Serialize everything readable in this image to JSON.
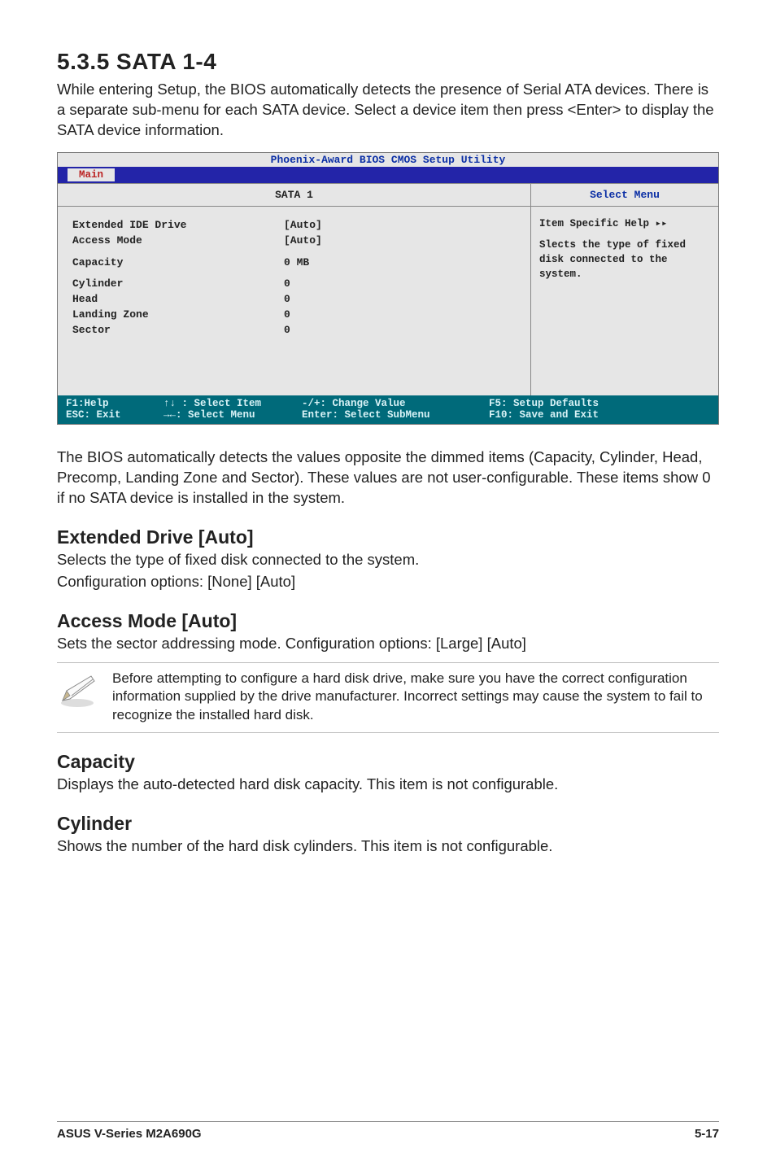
{
  "section_heading": "5.3.5   SATA 1-4",
  "intro_text": "While entering Setup, the BIOS automatically detects the presence of Serial ATA devices. There is a separate sub-menu for each SATA device. Select a device item then press <Enter> to display the SATA device information.",
  "bios": {
    "title": "Phoenix-Award BIOS CMOS Setup Utility",
    "tab": "Main",
    "left_header": "SATA 1",
    "right_header": "Select Menu",
    "fields": {
      "ext_ide_label": "Extended IDE Drive",
      "ext_ide_value": "[Auto]",
      "access_mode_label": "Access Mode",
      "access_mode_value": "[Auto]",
      "capacity_label": "Capacity",
      "capacity_value": "0 MB",
      "cylinder_label": "Cylinder",
      "cylinder_value": "0",
      "head_label": "Head",
      "head_value": "0",
      "landing_zone_label": "Landing Zone",
      "landing_zone_value": "0",
      "sector_label": "Sector",
      "sector_value": "0"
    },
    "help_title": "Item Specific Help ▸▸",
    "help_body": "Slects the type of fixed disk connected to the system.",
    "footer": {
      "f1": "F1:Help",
      "esc": "ESC: Exit",
      "sel_item": "↑↓ : Select Item",
      "sel_menu": "→←: Select Menu",
      "change": "-/+: Change Value",
      "enter": "Enter: Select SubMenu",
      "f5": "F5: Setup Defaults",
      "f10": "F10: Save and Exit"
    }
  },
  "post_bios_text": "The BIOS automatically detects the values opposite the dimmed items (Capacity, Cylinder,  Head, Precomp, Landing Zone and Sector). These values are not user-configurable. These items show 0 if no SATA device is installed in the system.",
  "ext_drive_heading": "Extended Drive [Auto]",
  "ext_drive_p1": "Selects the type of fixed disk connected to the system.",
  "ext_drive_p2": "Configuration options: [None] [Auto]",
  "access_mode_heading": "Access Mode [Auto]",
  "access_mode_p": "Sets the sector addressing mode. Configuration options: [Large] [Auto]",
  "note_text": "Before attempting to configure a hard disk drive, make sure you have the correct configuration information supplied by the drive manufacturer. Incorrect settings may cause the system to fail to recognize the installed hard disk.",
  "capacity_heading": "Capacity",
  "capacity_p": "Displays the auto-detected hard disk capacity. This item is not configurable.",
  "cylinder_heading": "Cylinder",
  "cylinder_p": "Shows the number of the hard disk cylinders. This item is not configurable.",
  "footer_left": "ASUS V-Series M2A690G",
  "footer_right": "5-17"
}
